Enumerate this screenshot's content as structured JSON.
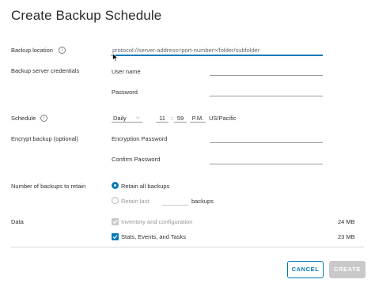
{
  "dialog": {
    "title": "Create Backup Schedule"
  },
  "backup_location": {
    "label": "Backup location",
    "placeholder": "protocol://server-address<port-number>/folder/subfolder"
  },
  "credentials": {
    "label": "Backup server credentials",
    "user_name_label": "User name",
    "user_name_value": "",
    "password_label": "Password",
    "password_value": ""
  },
  "schedule": {
    "label": "Schedule",
    "frequency": "Daily",
    "hour": "11",
    "separator": ":",
    "minute": "59",
    "ampm": "P.M.",
    "timezone": "US/Pacific"
  },
  "encrypt": {
    "label": "Encrypt backup (optional)",
    "encryption_password_label": "Encryption Password",
    "encryption_password_value": "",
    "confirm_password_label": "Confirm Password",
    "confirm_password_value": ""
  },
  "retention": {
    "label": "Number of backups to retain",
    "option_all": "Retain all backups",
    "option_last": "Retain last",
    "last_value": "",
    "suffix": "backups",
    "selected": "all"
  },
  "data": {
    "label": "Data",
    "items": [
      {
        "label": "Inventory and configuration",
        "size": "24 MB",
        "checked": true,
        "disabled": true
      },
      {
        "label": "Stats, Events, and Tasks",
        "size": "23 MB",
        "checked": true,
        "disabled": false
      }
    ]
  },
  "footer": {
    "cancel_label": "CANCEL",
    "create_label": "CREATE"
  },
  "colors": {
    "accent": "#0079b8",
    "disabled": "#c9c9c9"
  },
  "icons": [
    "info-icon",
    "chevron-down-icon",
    "mouse-cursor-icon",
    "checkmark-icon"
  ]
}
